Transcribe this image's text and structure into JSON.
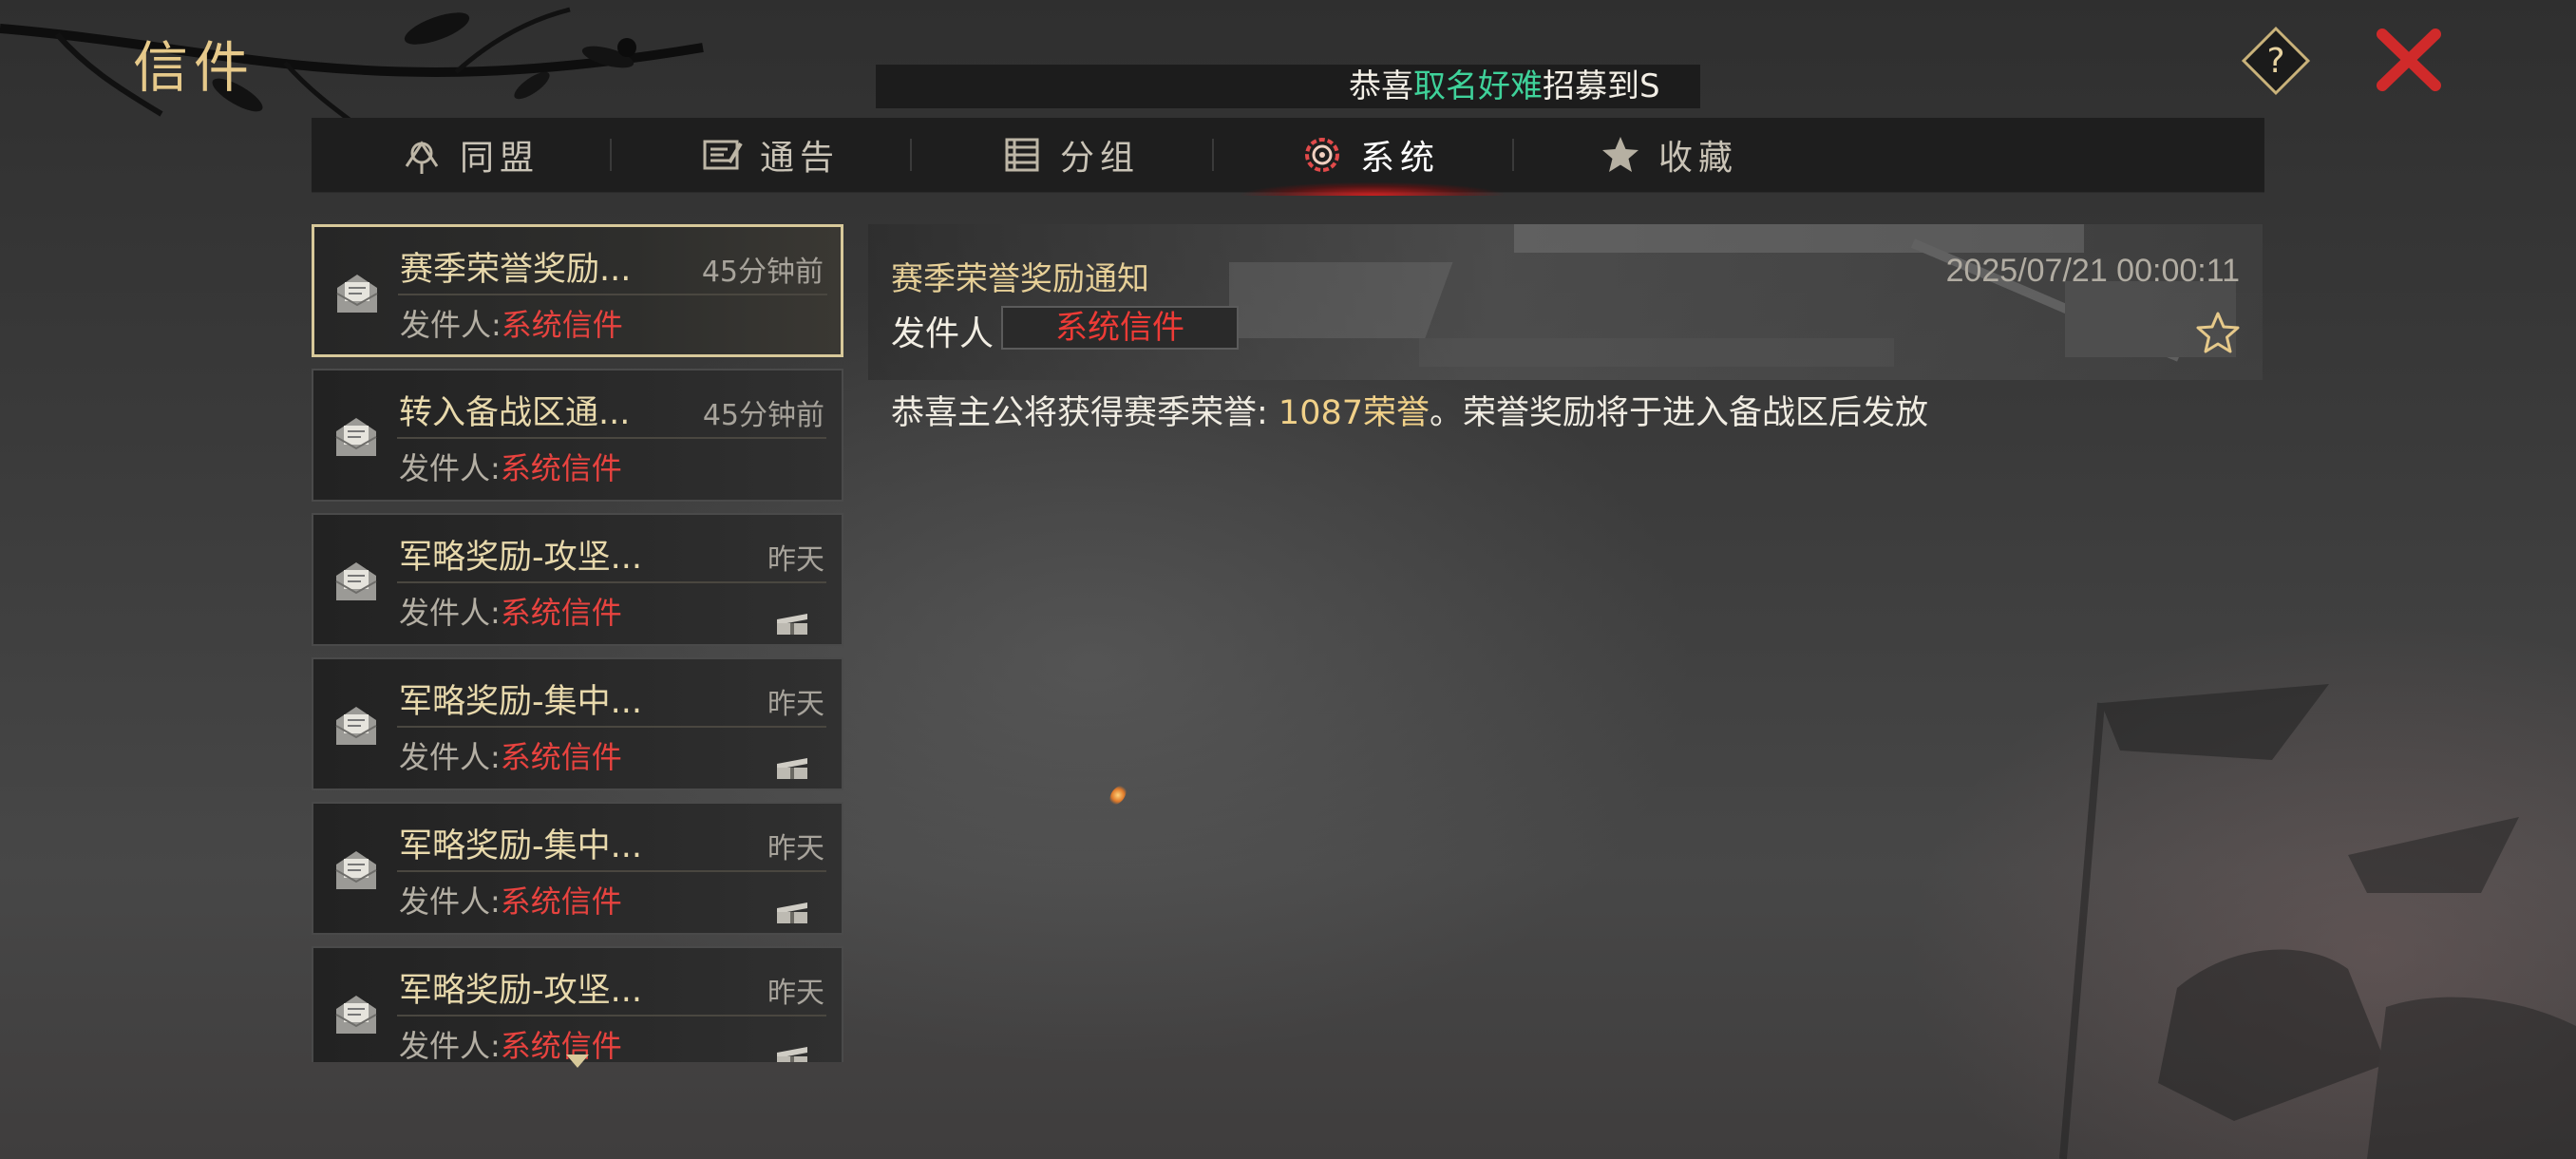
{
  "window": {
    "title": "信件"
  },
  "ticker": {
    "prefix": "恭喜",
    "player": "取名好难",
    "suffix": "招募到S"
  },
  "top_buttons": {
    "help_icon": "question-diamond-icon",
    "close_icon": "close-x-icon"
  },
  "tabs": [
    {
      "label": "同盟",
      "icon": "alliance-icon",
      "active": false
    },
    {
      "label": "通告",
      "icon": "notice-icon",
      "active": false
    },
    {
      "label": "分组",
      "icon": "group-list-icon",
      "active": false
    },
    {
      "label": "系统",
      "icon": "system-gear-icon",
      "active": true
    },
    {
      "label": "收藏",
      "icon": "star-icon",
      "active": false
    }
  ],
  "mail_list": {
    "sender_prefix": "发件人:",
    "items": [
      {
        "subject": "赛季荣誉奖励...",
        "time": "45分钟前",
        "sender": "系统信件",
        "selected": true,
        "has_attachment": false
      },
      {
        "subject": "转入备战区通...",
        "time": "45分钟前",
        "sender": "系统信件",
        "selected": false,
        "has_attachment": false
      },
      {
        "subject": "军略奖励-攻坚...",
        "time": "昨天",
        "sender": "系统信件",
        "selected": false,
        "has_attachment": true
      },
      {
        "subject": "军略奖励-集中...",
        "time": "昨天",
        "sender": "系统信件",
        "selected": false,
        "has_attachment": true
      },
      {
        "subject": "军略奖励-集中...",
        "time": "昨天",
        "sender": "系统信件",
        "selected": false,
        "has_attachment": true
      },
      {
        "subject": "军略奖励-攻坚...",
        "time": "昨天",
        "sender": "系统信件",
        "selected": false,
        "has_attachment": true
      }
    ]
  },
  "detail": {
    "subject": "赛季荣誉奖励通知",
    "date": "2025/07/21 00:00:11",
    "sender_label": "发件人",
    "sender": "系统信件",
    "body_prefix": "恭喜主公将获得赛季荣誉: ",
    "body_highlight": "1087荣誉",
    "body_suffix": "。荣誉奖励将于进入备战区后发放"
  },
  "colors": {
    "accent_gold": "#e6c98a",
    "sender_red": "#e8433f",
    "ticker_green": "#3fd29a",
    "active_tab_glow": "#dc1e1e"
  }
}
